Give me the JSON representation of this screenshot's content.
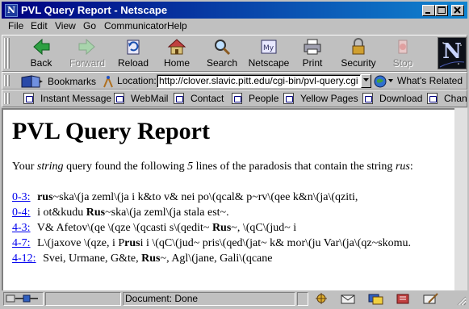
{
  "window": {
    "title": "PVL Query Report - Netscape",
    "icon_letter": "N"
  },
  "menu": [
    "File",
    "Edit",
    "View",
    "Go",
    "Communicator",
    "Help"
  ],
  "toolbar": {
    "back": "Back",
    "forward": "Forward",
    "reload": "Reload",
    "home": "Home",
    "search": "Search",
    "netscape": "Netscape",
    "print": "Print",
    "security": "Security",
    "stop": "Stop"
  },
  "location": {
    "bookmarks_label": "Bookmarks",
    "location_label": "Location:",
    "url": "http://clover.slavic.pitt.edu/cgi-bin/pvl-query.cgi",
    "whats_related": "What's Related"
  },
  "personal_toolbar": [
    "Instant Message",
    "WebMail",
    "Contact",
    "People",
    "Yellow Pages",
    "Download",
    "Chan"
  ],
  "page": {
    "heading": "PVL Query Report",
    "summary_prefix": "Your ",
    "summary_type": "string",
    "summary_mid": " query found the following ",
    "summary_count": "5",
    "summary_suffix": " lines of the paradosis that contain the string ",
    "summary_term": "rus",
    "summary_end": ":",
    "results": [
      {
        "ref": "0-3:",
        "pre": " ",
        "bold": "rus",
        "post": "~ska\\(ja zeml\\(ja i k&to v& nei po\\(qcal& p~rv\\(qee k&n\\(ja\\(qziti,"
      },
      {
        "ref": "0-4:",
        "pre": " i ot&kudu ",
        "bold": "Rus",
        "post": "~ska\\(ja zeml\\(ja stala est~."
      },
      {
        "ref": "4-3:",
        "pre": " V& Afetov\\(qe \\(qze \\(qcasti s\\(qedit~ ",
        "bold": "Rus",
        "post": "~, \\(qC\\(jud~ i"
      },
      {
        "ref": "4-7:",
        "pre": " L\\(jaxove \\(qze, i P",
        "bold": "rus",
        "post": "i i \\(qC\\(jud~ pris\\(qed\\(jat~ k& mor\\(ju Var\\(ja\\(qz~skomu."
      },
      {
        "ref": "4-12:",
        "pre": " Svei, Urmane, G&te, ",
        "bold": "Rus",
        "post": "~, Agl\\(jane, Gali\\(qcane"
      }
    ]
  },
  "status": {
    "text": "Document: Done"
  },
  "colors": {
    "titlebar_start": "#000080",
    "titlebar_end": "#1084d0",
    "link": "#0000ee",
    "chrome": "#c0c0c0"
  }
}
